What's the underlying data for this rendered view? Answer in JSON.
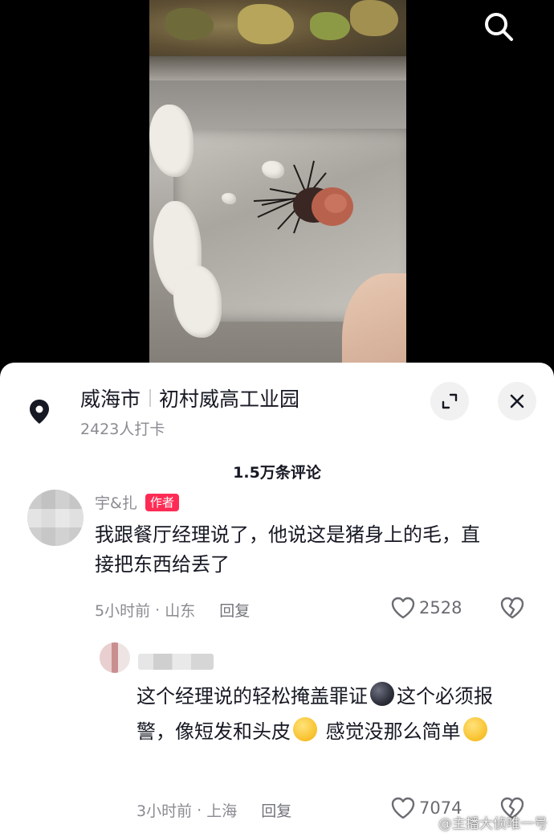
{
  "video": {
    "search_icon": "search-icon"
  },
  "location": {
    "city": "威海市",
    "place": "初村威高工业园",
    "checkins": "2423人打卡",
    "pin_icon": "location-pin-icon",
    "expand_icon": "expand-icon",
    "close_icon": "close-icon"
  },
  "comments_header": {
    "count": "1.5万条评论"
  },
  "comments": [
    {
      "name": "宇&扎",
      "tag": "作者",
      "text": "我跟餐厅经理说了，他说这是猪身上的毛，直接把东西给丢了",
      "time": "5小时前",
      "region": "山东",
      "reply_label": "回复",
      "likes": "2528"
    },
    {
      "text_parts": [
        "这个经理说的轻松掩盖罪证",
        "这个必须报警，像短发和头皮",
        " 感觉没那么简单"
      ],
      "time": "3小时前",
      "region": "上海",
      "reply_label": "回复",
      "likes": "7074"
    }
  ],
  "colors": {
    "author_tag": "#fe2c55",
    "muted_text": "#8a8b91",
    "primary_text": "#161823"
  },
  "watermark": {
    "text": "@主播大侦唯一号"
  }
}
